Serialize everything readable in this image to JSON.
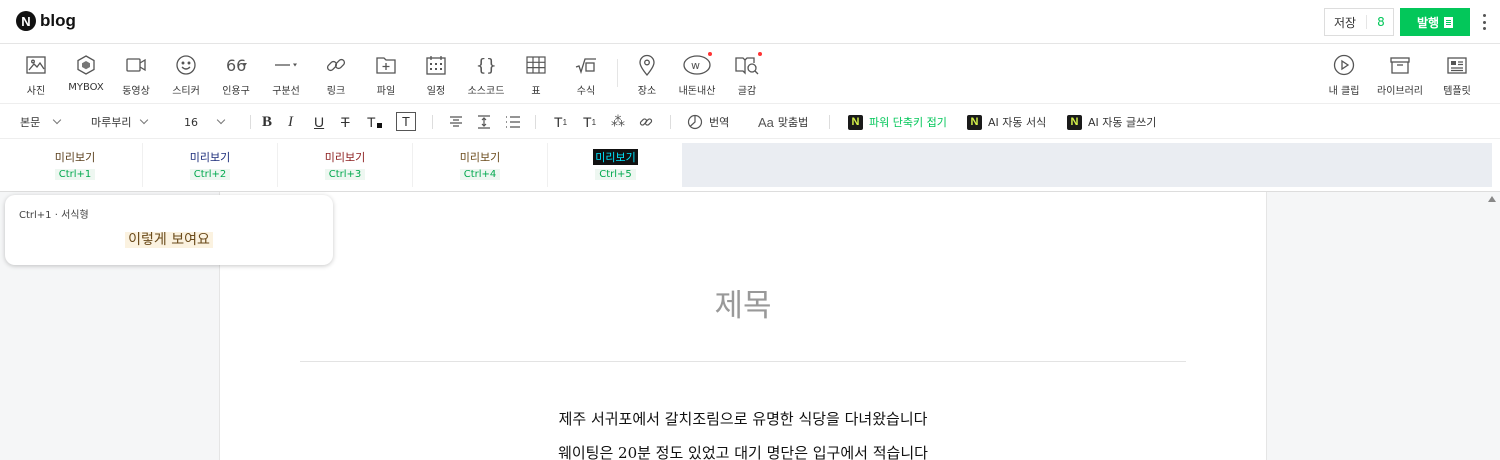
{
  "header": {
    "logo_letter": "N",
    "logo_text": "blog",
    "save_label": "저장",
    "save_count": "8",
    "publish_label": "발행"
  },
  "insert_toolbar": {
    "items": [
      {
        "label": "사진",
        "icon": "photo-icon"
      },
      {
        "label": "MYBOX",
        "icon": "mybox-icon"
      },
      {
        "label": "동영상",
        "icon": "video-icon"
      },
      {
        "label": "스티커",
        "icon": "sticker-icon"
      },
      {
        "label": "인용구",
        "icon": "quote-icon"
      },
      {
        "label": "구분선",
        "icon": "divider-icon"
      },
      {
        "label": "링크",
        "icon": "link-icon"
      },
      {
        "label": "파일",
        "icon": "file-icon"
      },
      {
        "label": "일정",
        "icon": "calendar-icon"
      },
      {
        "label": "소스코드",
        "icon": "code-icon"
      },
      {
        "label": "표",
        "icon": "table-icon"
      },
      {
        "label": "수식",
        "icon": "formula-icon"
      },
      {
        "label": "장소",
        "icon": "place-icon"
      },
      {
        "label": "내돈내산",
        "icon": "purchase-icon"
      },
      {
        "label": "글감",
        "icon": "material-icon"
      }
    ],
    "right_items": [
      {
        "label": "내 클립",
        "icon": "clip-icon"
      },
      {
        "label": "라이브러리",
        "icon": "library-icon"
      },
      {
        "label": "템플릿",
        "icon": "template-icon"
      }
    ]
  },
  "format_toolbar": {
    "paragraph_style": "본문",
    "font": "마루부리",
    "font_size": "16",
    "translate_label": "번역",
    "spellcheck_label": "맞춤법",
    "shortcut_label": "파워 단축키 접기",
    "ai_style_label": "AI 자동 서식",
    "ai_write_label": "AI 자동 글쓰기"
  },
  "style_presets": [
    {
      "preview": "미리보기",
      "shortcut": "Ctrl+1",
      "color": "#5a3e1b"
    },
    {
      "preview": "미리보기",
      "shortcut": "Ctrl+2",
      "color": "#1a2b7a"
    },
    {
      "preview": "미리보기",
      "shortcut": "Ctrl+3",
      "color": "#8b1c1c"
    },
    {
      "preview": "미리보기",
      "shortcut": "Ctrl+4",
      "color": "#6a4a1a"
    },
    {
      "preview": "미리보기",
      "shortcut": "Ctrl+5",
      "color": "#00e5ff"
    }
  ],
  "popover": {
    "header": "Ctrl+1 · 서식형",
    "preview_text": "이렇게 보여요"
  },
  "document": {
    "title_placeholder": "제목",
    "paragraphs": [
      "제주 서귀포에서 갈치조림으로 유명한 식당을 다녀왔습니다",
      "웨이팅은 20분 정도 있었고 대기 명단은 입구에서 적습니다"
    ]
  },
  "colors": {
    "accent_green": "#03c75a",
    "notification_dot": "#ff3333"
  }
}
